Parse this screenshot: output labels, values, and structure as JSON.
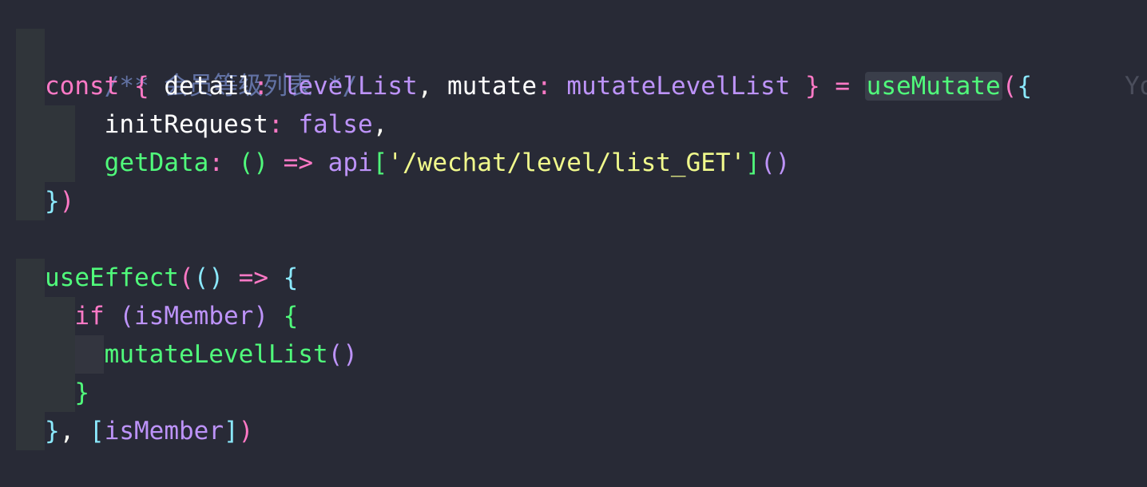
{
  "code": {
    "comment": "/** 会员等级列表 */",
    "l1": {
      "kw": "const",
      "open": "{",
      "detail": "detail",
      "levelList": "levelList",
      "mutate": "mutate",
      "mutateLevelList": "mutateLevelList",
      "close": "}",
      "eq": "=",
      "fn": "useMutate",
      "paren": "(",
      "brace": "{",
      "ghost": "Yo"
    },
    "l2": {
      "prop": "initRequest",
      "val": "false"
    },
    "l3": {
      "prop": "getData",
      "arrow": "=>",
      "api": "api",
      "str": "'/wechat/level/list_GET'"
    },
    "l4": {
      "brace": "}",
      "paren": ")"
    },
    "l5": {
      "fn": "useEffect",
      "arrow": "=>"
    },
    "l6": {
      "kw": "if",
      "cond": "isMember"
    },
    "l7": {
      "fn": "mutateLevelList",
      "call": "()"
    },
    "l8": {
      "brace": "}"
    },
    "l9": {
      "brace": "}",
      "dep": "isMember"
    }
  },
  "colors": {
    "background": "#282a36",
    "comment": "#6272a4",
    "keyword": "#ff79c6",
    "function": "#50fa7b",
    "property": "#bd93f9",
    "string": "#f1fa8c",
    "bracket_cyan": "#8be9fd"
  }
}
